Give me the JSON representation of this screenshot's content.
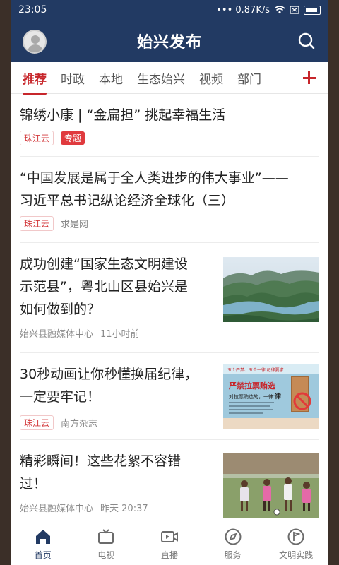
{
  "status_bar": {
    "time": "23:05",
    "network": "••• 0.87K/s"
  },
  "header": {
    "title": "始兴发布"
  },
  "tabs": [
    "推荐",
    "时政",
    "本地",
    "生态始兴",
    "视频",
    "部门"
  ],
  "articles": [
    {
      "title": "锦绣小康 | “金扁担” 挑起幸福生活",
      "source": "珠江云",
      "tag": "专题"
    },
    {
      "title_line1": "“中国发展是属于全人类进步的伟大事业”——",
      "title_line2": "习近平总书记纵论经济全球化（三）",
      "source": "珠江云",
      "origin": "求是网"
    },
    {
      "title_line1": "成功创建“国家生态文明建设",
      "title_line2": "示范县”，粤北山区县始兴是",
      "title_line3": "如何做到的？",
      "source": "始兴县融媒体中心",
      "time": "11小时前",
      "thumb_icon": "mountain-lake-photo"
    },
    {
      "title_line1": "30秒动画让你秒懂换届纪律，",
      "title_line2": "一定要牢记！",
      "source": "珠江云",
      "origin": "南方杂志",
      "thumb_icon": "anti-bribery-poster",
      "poster_tags": "五个严禁、五个一律 纪律要求",
      "poster_headline": "严禁拉票贿选",
      "poster_rule": "对拉票贿选的，一律",
      "poster_word": "一律"
    },
    {
      "title_line1": "精彩瞬间！这些花絮不容错",
      "title_line2": "过！",
      "source": "始兴县融媒体中心",
      "time": "昨天 20:37",
      "thumb_icon": "youth-football-photo"
    }
  ],
  "bottom_nav": [
    {
      "label": "首页",
      "icon": "home-icon"
    },
    {
      "label": "电视",
      "icon": "tv-icon"
    },
    {
      "label": "直播",
      "icon": "video-play-icon"
    },
    {
      "label": "服务",
      "icon": "compass-icon"
    },
    {
      "label": "文明实践",
      "icon": "flag-badge-icon"
    }
  ],
  "colors": {
    "primary": "#223a63",
    "accent": "#c7262b",
    "bg": "#ffffff"
  }
}
